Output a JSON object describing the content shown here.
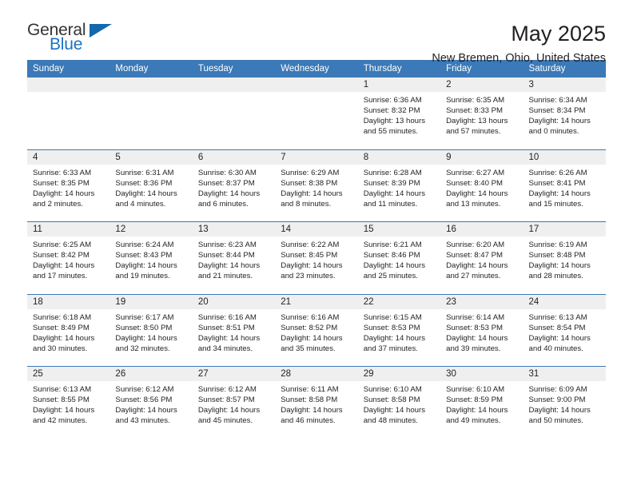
{
  "logo": {
    "word_primary": "General",
    "word_secondary": "Blue",
    "triangle_color": "#1367ad",
    "secondary_color": "#1a73c4"
  },
  "header": {
    "title": "May 2025",
    "subtitle": "New Bremen, Ohio, United States"
  },
  "theme": {
    "header_bar_color": "#3b79b8",
    "day_number_bg": "#efefef",
    "text_color": "#231f20"
  },
  "weekdays": [
    "Sunday",
    "Monday",
    "Tuesday",
    "Wednesday",
    "Thursday",
    "Friday",
    "Saturday"
  ],
  "weeks": [
    [
      {
        "day": "",
        "empty": true
      },
      {
        "day": "",
        "empty": true
      },
      {
        "day": "",
        "empty": true
      },
      {
        "day": "",
        "empty": true
      },
      {
        "day": "1",
        "sunrise": "Sunrise: 6:36 AM",
        "sunset": "Sunset: 8:32 PM",
        "daylight_1": "Daylight: 13 hours",
        "daylight_2": "and 55 minutes."
      },
      {
        "day": "2",
        "sunrise": "Sunrise: 6:35 AM",
        "sunset": "Sunset: 8:33 PM",
        "daylight_1": "Daylight: 13 hours",
        "daylight_2": "and 57 minutes."
      },
      {
        "day": "3",
        "sunrise": "Sunrise: 6:34 AM",
        "sunset": "Sunset: 8:34 PM",
        "daylight_1": "Daylight: 14 hours",
        "daylight_2": "and 0 minutes."
      }
    ],
    [
      {
        "day": "4",
        "sunrise": "Sunrise: 6:33 AM",
        "sunset": "Sunset: 8:35 PM",
        "daylight_1": "Daylight: 14 hours",
        "daylight_2": "and 2 minutes."
      },
      {
        "day": "5",
        "sunrise": "Sunrise: 6:31 AM",
        "sunset": "Sunset: 8:36 PM",
        "daylight_1": "Daylight: 14 hours",
        "daylight_2": "and 4 minutes."
      },
      {
        "day": "6",
        "sunrise": "Sunrise: 6:30 AM",
        "sunset": "Sunset: 8:37 PM",
        "daylight_1": "Daylight: 14 hours",
        "daylight_2": "and 6 minutes."
      },
      {
        "day": "7",
        "sunrise": "Sunrise: 6:29 AM",
        "sunset": "Sunset: 8:38 PM",
        "daylight_1": "Daylight: 14 hours",
        "daylight_2": "and 8 minutes."
      },
      {
        "day": "8",
        "sunrise": "Sunrise: 6:28 AM",
        "sunset": "Sunset: 8:39 PM",
        "daylight_1": "Daylight: 14 hours",
        "daylight_2": "and 11 minutes."
      },
      {
        "day": "9",
        "sunrise": "Sunrise: 6:27 AM",
        "sunset": "Sunset: 8:40 PM",
        "daylight_1": "Daylight: 14 hours",
        "daylight_2": "and 13 minutes."
      },
      {
        "day": "10",
        "sunrise": "Sunrise: 6:26 AM",
        "sunset": "Sunset: 8:41 PM",
        "daylight_1": "Daylight: 14 hours",
        "daylight_2": "and 15 minutes."
      }
    ],
    [
      {
        "day": "11",
        "sunrise": "Sunrise: 6:25 AM",
        "sunset": "Sunset: 8:42 PM",
        "daylight_1": "Daylight: 14 hours",
        "daylight_2": "and 17 minutes."
      },
      {
        "day": "12",
        "sunrise": "Sunrise: 6:24 AM",
        "sunset": "Sunset: 8:43 PM",
        "daylight_1": "Daylight: 14 hours",
        "daylight_2": "and 19 minutes."
      },
      {
        "day": "13",
        "sunrise": "Sunrise: 6:23 AM",
        "sunset": "Sunset: 8:44 PM",
        "daylight_1": "Daylight: 14 hours",
        "daylight_2": "and 21 minutes."
      },
      {
        "day": "14",
        "sunrise": "Sunrise: 6:22 AM",
        "sunset": "Sunset: 8:45 PM",
        "daylight_1": "Daylight: 14 hours",
        "daylight_2": "and 23 minutes."
      },
      {
        "day": "15",
        "sunrise": "Sunrise: 6:21 AM",
        "sunset": "Sunset: 8:46 PM",
        "daylight_1": "Daylight: 14 hours",
        "daylight_2": "and 25 minutes."
      },
      {
        "day": "16",
        "sunrise": "Sunrise: 6:20 AM",
        "sunset": "Sunset: 8:47 PM",
        "daylight_1": "Daylight: 14 hours",
        "daylight_2": "and 27 minutes."
      },
      {
        "day": "17",
        "sunrise": "Sunrise: 6:19 AM",
        "sunset": "Sunset: 8:48 PM",
        "daylight_1": "Daylight: 14 hours",
        "daylight_2": "and 28 minutes."
      }
    ],
    [
      {
        "day": "18",
        "sunrise": "Sunrise: 6:18 AM",
        "sunset": "Sunset: 8:49 PM",
        "daylight_1": "Daylight: 14 hours",
        "daylight_2": "and 30 minutes."
      },
      {
        "day": "19",
        "sunrise": "Sunrise: 6:17 AM",
        "sunset": "Sunset: 8:50 PM",
        "daylight_1": "Daylight: 14 hours",
        "daylight_2": "and 32 minutes."
      },
      {
        "day": "20",
        "sunrise": "Sunrise: 6:16 AM",
        "sunset": "Sunset: 8:51 PM",
        "daylight_1": "Daylight: 14 hours",
        "daylight_2": "and 34 minutes."
      },
      {
        "day": "21",
        "sunrise": "Sunrise: 6:16 AM",
        "sunset": "Sunset: 8:52 PM",
        "daylight_1": "Daylight: 14 hours",
        "daylight_2": "and 35 minutes."
      },
      {
        "day": "22",
        "sunrise": "Sunrise: 6:15 AM",
        "sunset": "Sunset: 8:53 PM",
        "daylight_1": "Daylight: 14 hours",
        "daylight_2": "and 37 minutes."
      },
      {
        "day": "23",
        "sunrise": "Sunrise: 6:14 AM",
        "sunset": "Sunset: 8:53 PM",
        "daylight_1": "Daylight: 14 hours",
        "daylight_2": "and 39 minutes."
      },
      {
        "day": "24",
        "sunrise": "Sunrise: 6:13 AM",
        "sunset": "Sunset: 8:54 PM",
        "daylight_1": "Daylight: 14 hours",
        "daylight_2": "and 40 minutes."
      }
    ],
    [
      {
        "day": "25",
        "sunrise": "Sunrise: 6:13 AM",
        "sunset": "Sunset: 8:55 PM",
        "daylight_1": "Daylight: 14 hours",
        "daylight_2": "and 42 minutes."
      },
      {
        "day": "26",
        "sunrise": "Sunrise: 6:12 AM",
        "sunset": "Sunset: 8:56 PM",
        "daylight_1": "Daylight: 14 hours",
        "daylight_2": "and 43 minutes."
      },
      {
        "day": "27",
        "sunrise": "Sunrise: 6:12 AM",
        "sunset": "Sunset: 8:57 PM",
        "daylight_1": "Daylight: 14 hours",
        "daylight_2": "and 45 minutes."
      },
      {
        "day": "28",
        "sunrise": "Sunrise: 6:11 AM",
        "sunset": "Sunset: 8:58 PM",
        "daylight_1": "Daylight: 14 hours",
        "daylight_2": "and 46 minutes."
      },
      {
        "day": "29",
        "sunrise": "Sunrise: 6:10 AM",
        "sunset": "Sunset: 8:58 PM",
        "daylight_1": "Daylight: 14 hours",
        "daylight_2": "and 48 minutes."
      },
      {
        "day": "30",
        "sunrise": "Sunrise: 6:10 AM",
        "sunset": "Sunset: 8:59 PM",
        "daylight_1": "Daylight: 14 hours",
        "daylight_2": "and 49 minutes."
      },
      {
        "day": "31",
        "sunrise": "Sunrise: 6:09 AM",
        "sunset": "Sunset: 9:00 PM",
        "daylight_1": "Daylight: 14 hours",
        "daylight_2": "and 50 minutes."
      }
    ]
  ]
}
